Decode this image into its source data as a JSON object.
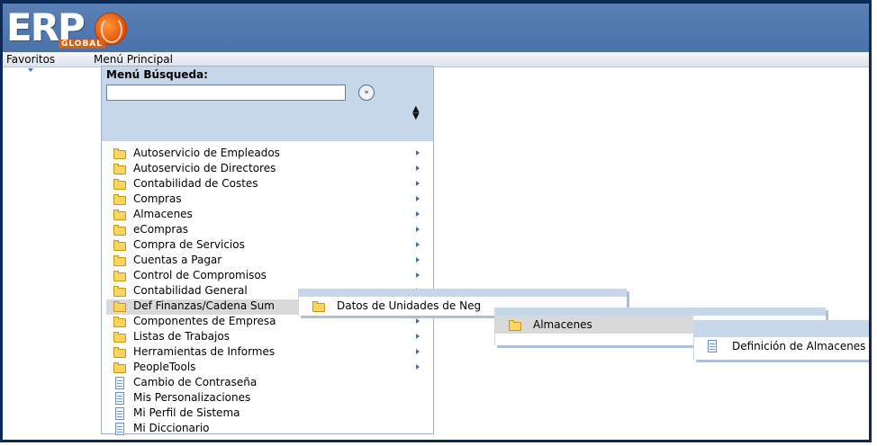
{
  "header": {
    "logo_text": "ERP",
    "logo_sub": "GLOBAL"
  },
  "nav": {
    "favorites": "Favoritos",
    "main_menu": "Menú Principal"
  },
  "search": {
    "label": "Menú Búsqueda:",
    "value": "",
    "go_icon": "»",
    "sort_icon": "▲▼"
  },
  "menu_items": [
    {
      "label": "Autoservicio de Empleados",
      "icon": "folder-icon",
      "has_submenu": true
    },
    {
      "label": "Autoservicio de Directores",
      "icon": "folder-icon",
      "has_submenu": true
    },
    {
      "label": "Contabilidad de Costes",
      "icon": "folder-icon",
      "has_submenu": true
    },
    {
      "label": "Compras",
      "icon": "folder-icon",
      "has_submenu": true
    },
    {
      "label": "Almacenes",
      "icon": "folder-icon",
      "has_submenu": true
    },
    {
      "label": "eCompras",
      "icon": "folder-icon",
      "has_submenu": true
    },
    {
      "label": "Compra de Servicios",
      "icon": "folder-icon",
      "has_submenu": true
    },
    {
      "label": "Cuentas a Pagar",
      "icon": "folder-icon",
      "has_submenu": true
    },
    {
      "label": "Control de Compromisos",
      "icon": "folder-icon",
      "has_submenu": true
    },
    {
      "label": "Contabilidad General",
      "icon": "folder-icon",
      "has_submenu": true
    },
    {
      "label": "Def Finanzas/Cadena Sum",
      "icon": "folder-icon",
      "has_submenu": true,
      "highlighted": true
    },
    {
      "label": "Componentes de Empresa",
      "icon": "folder-icon",
      "has_submenu": true
    },
    {
      "label": "Listas de Trabajos",
      "icon": "folder-icon",
      "has_submenu": true
    },
    {
      "label": "Herramientas de Informes",
      "icon": "folder-icon",
      "has_submenu": true
    },
    {
      "label": "PeopleTools",
      "icon": "folder-icon",
      "has_submenu": true
    },
    {
      "label": "Cambio de Contraseña",
      "icon": "document-icon",
      "has_submenu": false
    },
    {
      "label": "Mis Personalizaciones",
      "icon": "document-icon",
      "has_submenu": false
    },
    {
      "label": "Mi Perfil de Sistema",
      "icon": "document-icon",
      "has_submenu": false
    },
    {
      "label": "Mi Diccionario",
      "icon": "document-icon",
      "has_submenu": false
    }
  ],
  "flyouts": [
    {
      "label": "Datos de Unidades de Neg",
      "icon": "folder-icon"
    },
    {
      "label": "Almacenes",
      "icon": "folder-icon"
    },
    {
      "label": "Definición de Almacenes",
      "icon": "document-icon"
    }
  ],
  "colors": {
    "header_blue": "#4a72aa",
    "panel_blue": "#c6d7ea",
    "frame_navy": "#0b2a55",
    "highlight_gray": "#d9d9d9"
  }
}
